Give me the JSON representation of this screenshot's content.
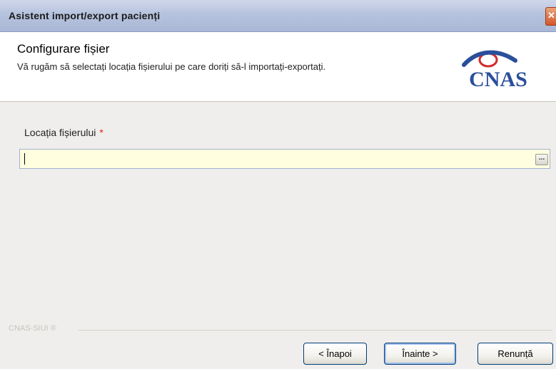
{
  "window": {
    "title": "Asistent import/export pacienți",
    "close_glyph": "✕"
  },
  "header": {
    "title": "Configurare fișier",
    "description": "Vă rugăm să selectați locația fișierului pe care doriți să-l importați-exportați.",
    "logo_text": "CNAS"
  },
  "form": {
    "file_location_label": "Locația fișierului",
    "required_marker": "*",
    "file_location_value": "",
    "browse_glyph": "..."
  },
  "footer": {
    "brand": "CNAS-SIUI ®"
  },
  "buttons": {
    "back": "< Înapoi",
    "next": "Înainte >",
    "cancel": "Renunță"
  },
  "colors": {
    "title_gradient_top": "#cfd7ea",
    "input_background": "#ffffdf",
    "required_star": "#e2201d",
    "logo_blue": "#2a4f9b",
    "logo_red": "#d22b2b"
  }
}
